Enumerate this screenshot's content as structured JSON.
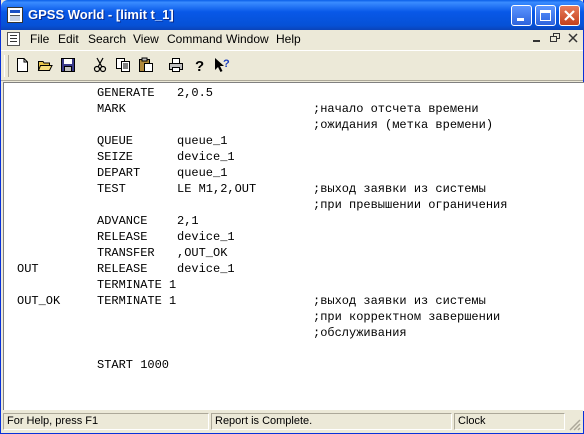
{
  "window": {
    "title": "GPSS World - [limit t_1]"
  },
  "menu": {
    "items": [
      "File",
      "Edit",
      "Search",
      "View",
      "Command",
      "Window",
      "Help"
    ]
  },
  "toolbar": {
    "buttons": [
      "new-icon",
      "open-icon",
      "save-icon",
      "cut-icon",
      "copy-icon",
      "paste-icon",
      "print-icon",
      "help-icon",
      "context-help-icon"
    ]
  },
  "code": {
    "lines": [
      {
        "label": "",
        "op": "GENERATE",
        "arg": "2,0.5",
        "comment": ""
      },
      {
        "label": "",
        "op": "MARK",
        "arg": "",
        "comment": ";начало отсчета времени"
      },
      {
        "label": "",
        "op": "",
        "arg": "",
        "comment": ";ожидания (метка времени)"
      },
      {
        "label": "",
        "op": "QUEUE",
        "arg": "queue_1",
        "comment": ""
      },
      {
        "label": "",
        "op": "SEIZE",
        "arg": "device_1",
        "comment": ""
      },
      {
        "label": "",
        "op": "DEPART",
        "arg": "queue_1",
        "comment": ""
      },
      {
        "label": "",
        "op": "TEST",
        "arg": "LE M1,2,OUT",
        "comment": ";выход заявки из системы"
      },
      {
        "label": "",
        "op": "",
        "arg": "",
        "comment": ";при превышении ограничения"
      },
      {
        "label": "",
        "op": "ADVANCE",
        "arg": "2,1",
        "comment": ""
      },
      {
        "label": "",
        "op": "RELEASE",
        "arg": "device_1",
        "comment": ""
      },
      {
        "label": "",
        "op": "TRANSFER",
        "arg": ",OUT_OK",
        "comment": ""
      },
      {
        "label": "OUT",
        "op": "RELEASE",
        "arg": "device_1",
        "comment": ""
      },
      {
        "label": "",
        "op": "TERMINATE 1",
        "arg": "",
        "comment": ""
      },
      {
        "label": "OUT_OK",
        "op": "TERMINATE 1",
        "arg": "",
        "comment": ";выход заявки из системы"
      },
      {
        "label": "",
        "op": "",
        "arg": "",
        "comment": ";при корректном завершении"
      },
      {
        "label": "",
        "op": "",
        "arg": "",
        "comment": ";обслуживания"
      },
      {
        "label": "",
        "op": "",
        "arg": "",
        "comment": ""
      },
      {
        "label": "",
        "op": "START 1000",
        "arg": "",
        "comment": ""
      }
    ]
  },
  "status": {
    "help": "For Help, press F1",
    "report": "Report is Complete.",
    "clock": "Clock"
  }
}
